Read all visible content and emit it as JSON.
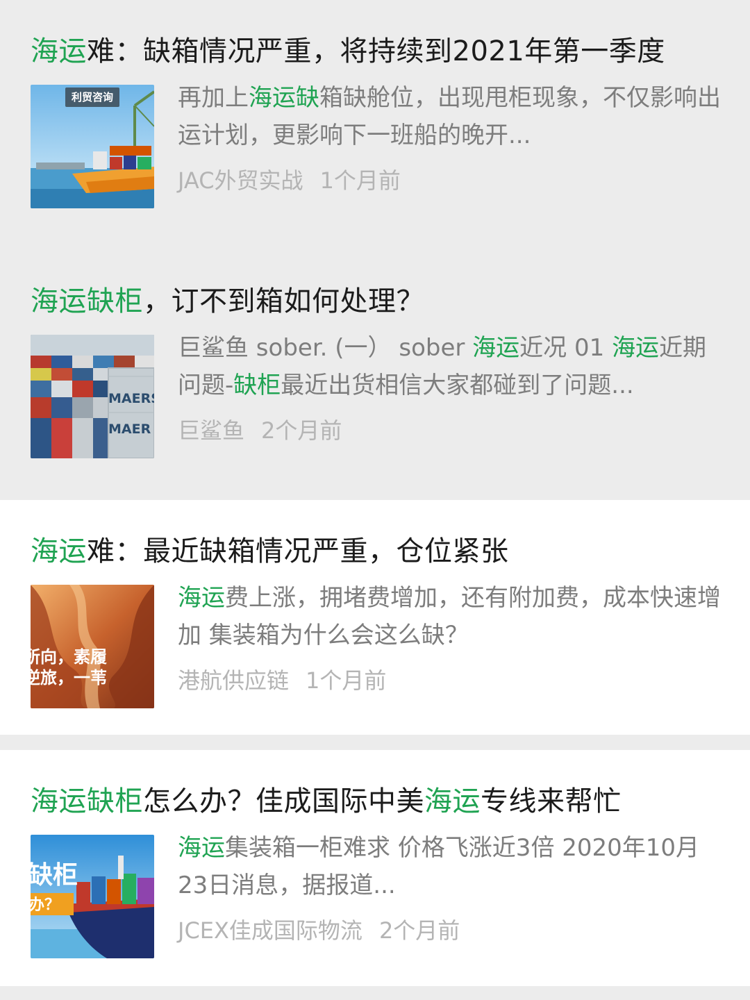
{
  "results": [
    {
      "title": [
        {
          "text": "海运",
          "hl": true
        },
        {
          "text": "难：缺箱情况严重，将持续到2021年第一季度",
          "hl": false
        }
      ],
      "snippet": [
        {
          "text": "再加上",
          "hl": false
        },
        {
          "text": "海运缺",
          "hl": true
        },
        {
          "text": "箱缺舱位，出现甩柜现象，不仅影响出运计划，更影响下一班船的晚开...",
          "hl": false
        }
      ],
      "source": "JAC外贸实战",
      "time": "1个月前",
      "thumb_text": "利贸咨询",
      "thumb_icon": "cargo-ship-port-image"
    },
    {
      "title": [
        {
          "text": "海运缺柜",
          "hl": true
        },
        {
          "text": "，订不到箱如何处理？",
          "hl": false
        }
      ],
      "snippet": [
        {
          "text": "巨鲨鱼 sober. (一） sober ",
          "hl": false
        },
        {
          "text": "海运",
          "hl": true
        },
        {
          "text": "近况 01 ",
          "hl": false
        },
        {
          "text": "海运",
          "hl": true
        },
        {
          "text": "近期问题-",
          "hl": false
        },
        {
          "text": "缺柜",
          "hl": true
        },
        {
          "text": "最近出货相信大家都碰到了问题...",
          "hl": false
        }
      ],
      "source": "巨鲨鱼",
      "time": "2个月前",
      "thumb_text": "MAERSK",
      "thumb_text_2": "MAER",
      "thumb_icon": "container-stacks-image"
    },
    {
      "title": [
        {
          "text": "海运",
          "hl": true
        },
        {
          "text": "难：最近缺箱情况严重，仓位紧张",
          "hl": false
        }
      ],
      "snippet": [
        {
          "text": "海运",
          "hl": true
        },
        {
          "text": "费上涨，拥堵费增加，还有附加费，成本快速增加 集装箱为什么会这么缺？",
          "hl": false
        }
      ],
      "source": "港航供应链",
      "time": "1个月前",
      "thumb_text": "所向，素履",
      "thumb_text_2": "逆旅，一苇",
      "thumb_icon": "canyon-image"
    },
    {
      "title": [
        {
          "text": "海运缺柜",
          "hl": true
        },
        {
          "text": "怎么办？佳成国际中美",
          "hl": false
        },
        {
          "text": "海运",
          "hl": true
        },
        {
          "text": "专线来帮忙",
          "hl": false
        }
      ],
      "snippet": [
        {
          "text": "海运",
          "hl": true
        },
        {
          "text": "集装箱一柜难求 价格飞涨近3倍 2020年10月23日消息，据报道...",
          "hl": false
        }
      ],
      "source": "JCEX佳成国际物流",
      "time": "2个月前",
      "thumb_text": "缺柜",
      "thumb_text_2": "办？",
      "thumb_icon": "container-ship-sea-image"
    }
  ],
  "colors": {
    "highlight": "#1fa352",
    "title": "#1b1b1b",
    "snippet": "#7d7d7d",
    "meta": "#b4b4b4"
  }
}
